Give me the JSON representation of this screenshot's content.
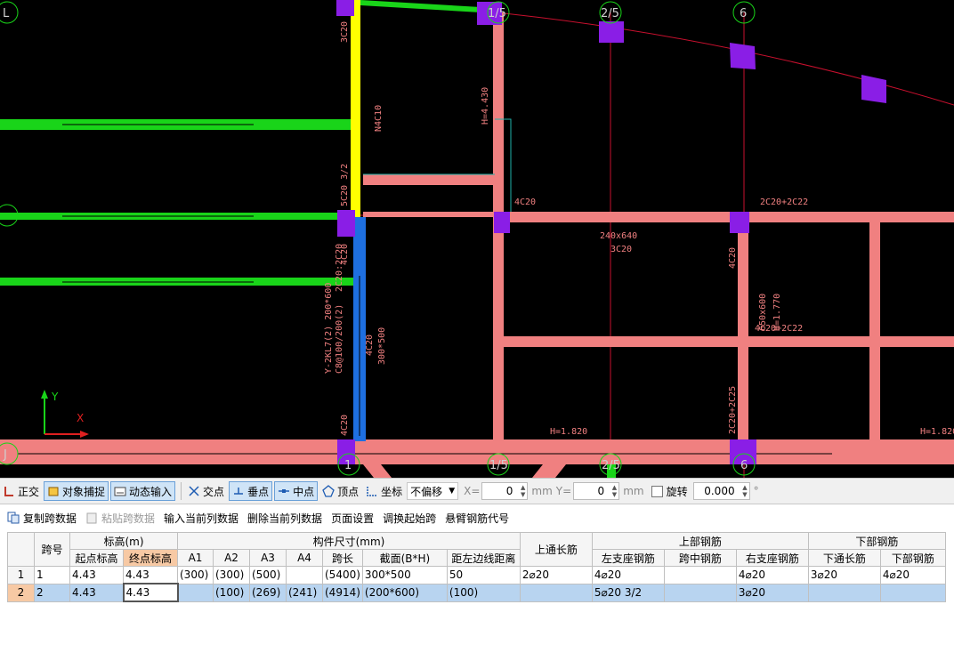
{
  "cad": {
    "axis_labels": [
      "L",
      "1/5",
      "2/5",
      "6",
      "J"
    ],
    "bottom_labels": [
      "1",
      "1/5",
      "2/5",
      "6"
    ],
    "annotations": [
      "3C20",
      "N4C10",
      "H=4.430",
      "4C20",
      "2C20+2C22",
      "240x640",
      "3C20",
      "5C20 3/2",
      "4C20",
      "Y-2KL7(2) 200*600",
      "C8@100/200(2)",
      "2C20:2C20",
      "4C20",
      "300*500",
      "4C20",
      "650x600",
      "H=1.770",
      "4C20+2C22",
      "2C20+2C25",
      "H=1.820",
      "H=1.820",
      "4C20"
    ],
    "ucs": {
      "y": "Y",
      "x": "X"
    }
  },
  "snapbar": {
    "ortho": "正交",
    "object_snap": "对象捕捉",
    "dynamic_input": "动态输入",
    "intersection": "交点",
    "perpendicular": "垂点",
    "midpoint": "中点",
    "vertex": "顶点",
    "coordinate": "坐标",
    "offset_mode": "不偏移",
    "x_label": "X=",
    "x_value": "0",
    "y_label": "Y=",
    "y_value": "0",
    "unit": "mm",
    "rotate_label": "旋转",
    "rotate_value": "0.000",
    "degree": "°"
  },
  "opbar": {
    "copy": "复制跨数据",
    "paste": "粘贴跨数据",
    "input_col": "输入当前列数据",
    "delete_col": "删除当前列数据",
    "page_setup": "页面设置",
    "adjust_start": "调换起始跨",
    "cantilever": "悬臂钢筋代号"
  },
  "grid": {
    "group_headers": {
      "span": "跨号",
      "elevation": "标高(m)",
      "dimensions": "构件尺寸(mm)",
      "top_through": "上通长筋",
      "top_rebar": "上部钢筋",
      "bottom_rebar": "下部钢筋"
    },
    "sub_headers": [
      "起点标高",
      "终点标高",
      "A1",
      "A2",
      "A3",
      "A4",
      "跨长",
      "截面(B*H)",
      "距左边线距离",
      "左支座钢筋",
      "跨中钢筋",
      "右支座钢筋",
      "下通长筋",
      "下部钢筋"
    ],
    "rows": [
      {
        "n": "1",
        "span": "1",
        "start": "4.43",
        "end": "4.43",
        "a1": "(300)",
        "a2": "(300)",
        "a3": "(500)",
        "a4": "",
        "len": "(5400)",
        "sec": "300*500",
        "dist": "50",
        "top": "2⌀20",
        "left": "4⌀20",
        "mid": "",
        "right": "4⌀20",
        "bthru": "3⌀20",
        "bot": "4⌀20"
      },
      {
        "n": "2",
        "span": "2",
        "start": "4.43",
        "end": "4.43",
        "a1": "",
        "a2": "(100)",
        "a3": "(269)",
        "a4": "(241)",
        "len": "(4914)",
        "sec": "(200*600)",
        "dist": "(100)",
        "top": "",
        "left": "5⌀20 3/2",
        "mid": "",
        "right": "3⌀20",
        "bthru": "",
        "bot": ""
      }
    ]
  }
}
